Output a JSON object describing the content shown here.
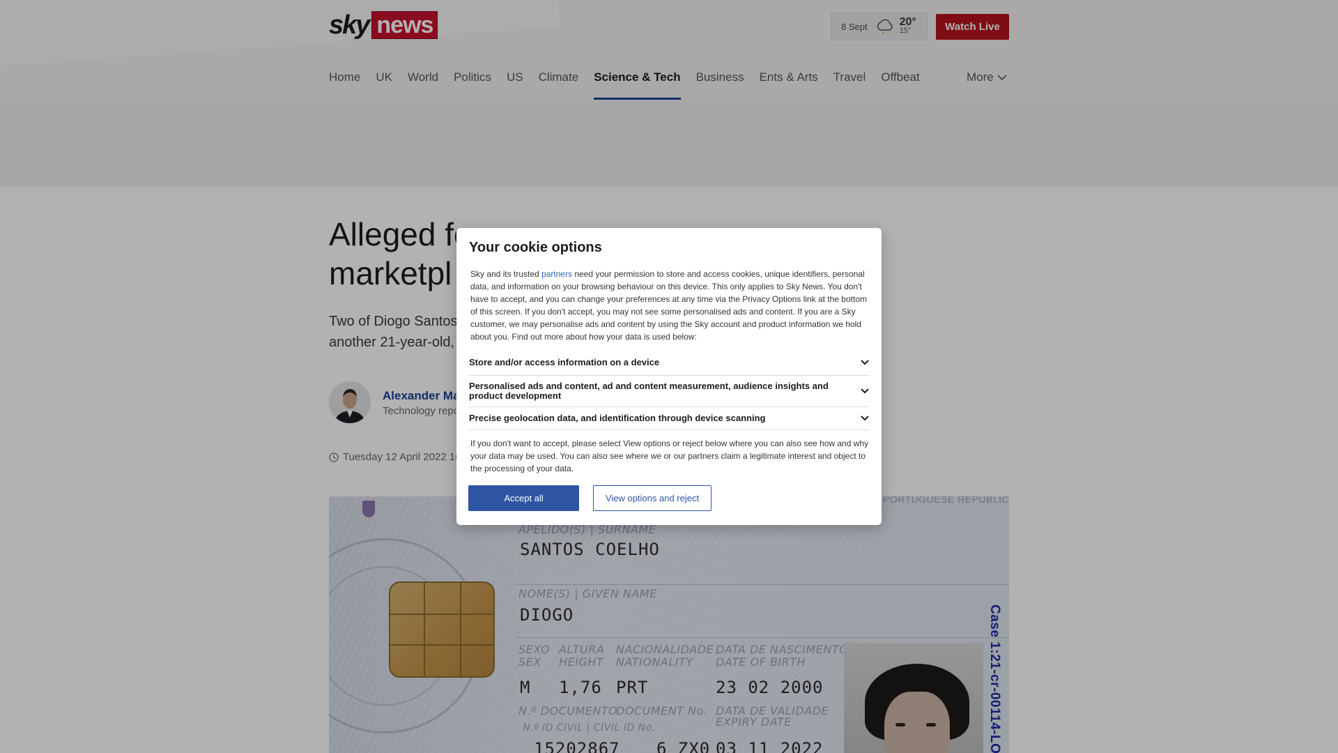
{
  "header": {
    "logo_sky": "sky",
    "logo_news": "news",
    "weather": {
      "date": "8 Sept",
      "high": "20°",
      "low": "15°",
      "icon": "cloud-sun-rain-icon"
    },
    "watch_live": "Watch Live"
  },
  "nav": {
    "items": [
      "Home",
      "UK",
      "World",
      "Politics",
      "US",
      "Climate",
      "Science & Tech",
      "Business",
      "Ents & Arts",
      "Travel",
      "Offbeat"
    ],
    "active": "Science & Tech",
    "more": "More"
  },
  "article": {
    "headline_visible": [
      "Alleged fo",
      "marketpl"
    ],
    "standfirst_visible": [
      "Two of Diogo Santos",
      "another 21-year-old,"
    ],
    "author_name": "Alexander Ma",
    "author_role": "Technology repo",
    "timestamp": "Tuesday 12 April 2022 16:"
  },
  "hero_image": {
    "header_text": "PORTUGUESE REPUBLIC",
    "surname_label": "APELIDO(S) | SURNAME",
    "surname": "SANTOS COELHO",
    "given_label": "NOME(S) | GIVEN NAME",
    "given": "DIOGO",
    "sex_label": "SEXO",
    "sex_label_en": "SEX",
    "sex": "M",
    "height_label": "ALTURA",
    "height_label_en": "HEIGHT",
    "height": "1,76",
    "nationality_label": "NACIONALIDADE",
    "nationality_label_en": "NATIONALITY",
    "nationality": "PRT",
    "dob_label": "DATA DE NASCIMENTO",
    "dob_label_en": "DATE OF BIRTH",
    "dob": "23 02 2000",
    "docno_label": "N.º DOCUMENTO",
    "docno_label_en": "DOCUMENT No.",
    "expiry_label": "DATA DE VALIDADE",
    "expiry_label_en": "EXPIRY DATE",
    "civil_label": "N.º ID CIVIL | CIVIL ID No.",
    "civil_id": "15202867",
    "doc_suffix": "6 ZX0",
    "expiry": "03 11 2022",
    "case_number": "Case 1:21-cr-00114-LO"
  },
  "cookie_dialog": {
    "title": "Your cookie options",
    "intro_prefix": "Sky and its trusted ",
    "intro_link": "partners",
    "intro_rest": " need your permission to store and access cookies, unique identifiers, personal data, and information on your browsing behaviour on this device. This only applies to Sky News. You don't have to accept, and you can change your preferences at any time via the Privacy Options link at the bottom of this screen. If you don't accept, you may not see some personalised ads and content.  If you are a Sky customer, we may personalise ads and content by using the Sky account and product information we hold about you. Find out more about how your data is used below:",
    "sections": [
      "Store and/or access information on a device",
      "Personalised ads and content, ad and content measurement, audience insights and product development",
      "Precise geolocation data, and identification through device scanning"
    ],
    "footer_text": "If you don't want to accept, please select View options or reject below where you can also see how and why your data may be used. You can also see where we or our partners claim a legitimate interest and object to the processing of your data.",
    "accept_label": "Accept all",
    "options_label": "View options and reject"
  },
  "colors": {
    "brand_red": "#c8102e",
    "watch_live_bg": "#b5141f",
    "accent_blue": "#2d55a3",
    "nav_underline": "#1c3f94"
  }
}
